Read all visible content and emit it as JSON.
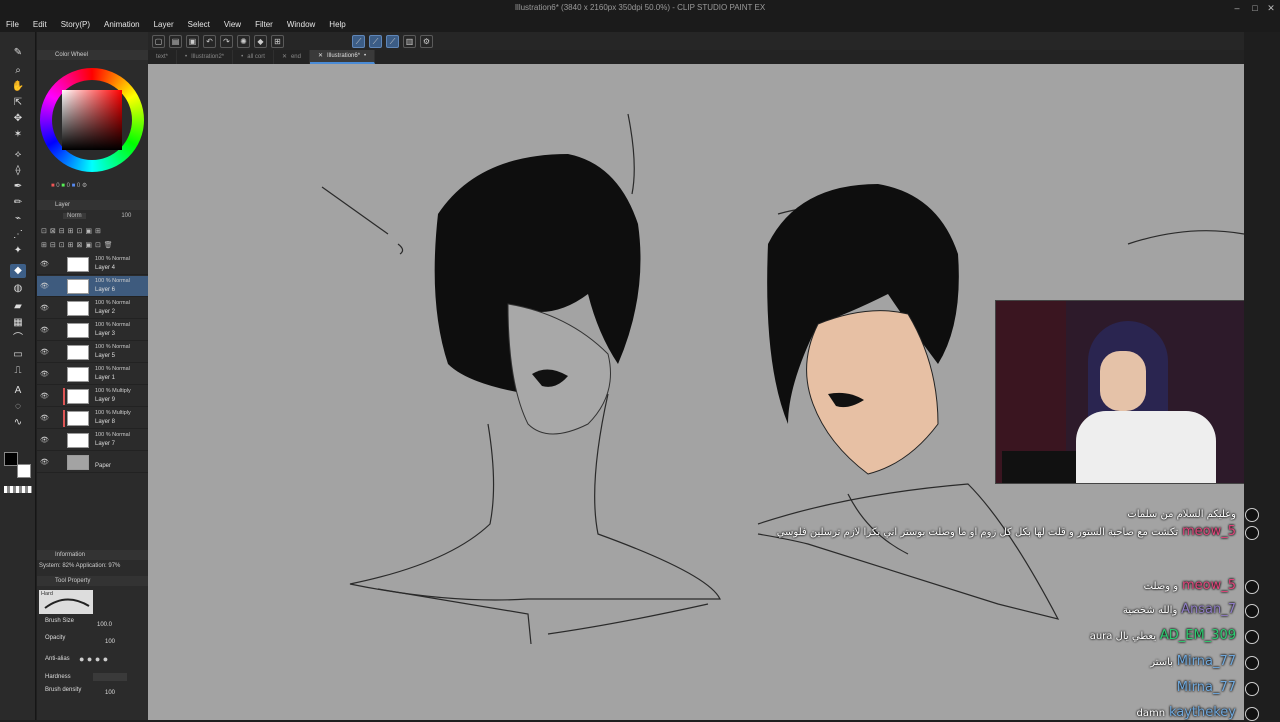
{
  "window": {
    "title": "Illustration6* (3840 x 2160px 350dpi 50.0%) - CLIP STUDIO PAINT EX"
  },
  "menu": [
    "File",
    "Edit",
    "Story(P)",
    "Animation",
    "Layer",
    "Select",
    "View",
    "Filter",
    "Window",
    "Help"
  ],
  "tabs": [
    {
      "label": "text*"
    },
    {
      "label": "Illustration2*"
    },
    {
      "label": "all cort"
    },
    {
      "label": "end"
    },
    {
      "label": "Illustration6*"
    }
  ],
  "panels": {
    "color_wheel": "Color Wheel",
    "layer": "Layer",
    "information": "Information",
    "tool_property": "Tool Property"
  },
  "layer_panel": {
    "blend_mode": "Norm",
    "opacity": "100"
  },
  "layers": [
    {
      "mode": "100 % Normal",
      "name": "Layer 4"
    },
    {
      "mode": "100 % Normal",
      "name": "Layer 6"
    },
    {
      "mode": "100 % Normal",
      "name": "Layer 2"
    },
    {
      "mode": "100 % Normal",
      "name": "Layer 3"
    },
    {
      "mode": "100 % Normal",
      "name": "Layer 5"
    },
    {
      "mode": "100 % Normal",
      "name": "Layer 1"
    },
    {
      "mode": "100 % Multiply",
      "name": "Layer 9"
    },
    {
      "mode": "100 % Multiply",
      "name": "Layer 8"
    },
    {
      "mode": "100 % Normal",
      "name": "Layer 7"
    },
    {
      "mode": "",
      "name": "Paper"
    }
  ],
  "info": {
    "text": "System: 82%  Application: 97%"
  },
  "tool_property": {
    "brush_name": "Hard",
    "brush_size_label": "Brush Size",
    "brush_size": "100.0",
    "opacity_label": "Opacity",
    "opacity": "100",
    "antialias_label": "Anti-alias",
    "hardness_label": "Hardness",
    "density_label": "Brush density",
    "density": "100"
  },
  "chat": [
    {
      "user": "",
      "msg": "وعليكم السلام من سلمات",
      "user_color": "#ffffff"
    },
    {
      "user": "meow_5",
      "msg": "تكشت مع صاحبة الستور و قلت لها بكل كل زوم او ما وصلت بوستر اني بكرا لازم ترسلين فلوسي",
      "user_color": "#e0457b"
    },
    {
      "user": "meow_5",
      "msg": "و وصلت",
      "user_color": "#e0457b"
    },
    {
      "user": "Ansan_7",
      "msg": "والله شخصية",
      "user_color": "#8e7cc3"
    },
    {
      "user": "AD_EM_309",
      "msg": "aura يعطي يال",
      "user_color": "#2ecc71"
    },
    {
      "user": "Mirna_77",
      "msg": "باستر",
      "user_color": "#6fa8dc"
    },
    {
      "user": "Mirna_77",
      "msg": "",
      "user_color": "#6fa8dc"
    },
    {
      "user": "kaythekey",
      "msg": "damn",
      "user_color": "#6fa8dc"
    }
  ],
  "colors": {
    "canvas_bg": "#a3a3a3",
    "accent": "#4a8bd6",
    "ui_bg": "#2b2b2b"
  }
}
